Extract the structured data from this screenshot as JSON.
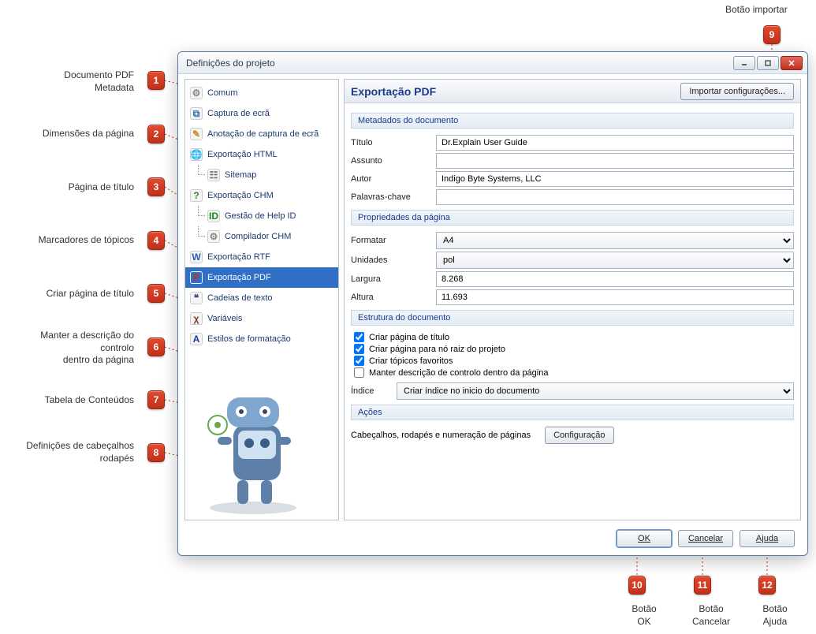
{
  "annotations": {
    "1": "Documento PDF\nMetadata",
    "2": "Dimensões da página",
    "3": "Página de título",
    "4": "Marcadores de tópicos",
    "5": "Criar página de título",
    "6": "Manter a descrição do\ncontrolo\ndentro da página",
    "7": "Tabela de Conteúdos",
    "8": "Definições de cabeçalhos\nrodapés",
    "9": "Botão importar",
    "10": "Botão\nOK",
    "11": "Botão\nCancelar",
    "12": "Botão\nAjuda"
  },
  "window": {
    "title": "Definições do projeto"
  },
  "nav": [
    {
      "label": "Comum",
      "icon": "⚙",
      "kind": "gear"
    },
    {
      "label": "Captura de ecrã",
      "icon": "⧉",
      "kind": "capture"
    },
    {
      "label": "Anotação de captura de ecrã",
      "icon": "✎",
      "kind": "annotate"
    },
    {
      "label": "Exportação HTML",
      "icon": "🌐",
      "kind": "html"
    },
    {
      "label": "Sitemap",
      "icon": "☷",
      "kind": "sitemap",
      "child": true
    },
    {
      "label": "Exportação CHM",
      "icon": "?",
      "kind": "chm"
    },
    {
      "label": "Gestão de Help ID",
      "icon": "ID",
      "kind": "helpid",
      "child": true
    },
    {
      "label": "Compilador CHM",
      "icon": "⚙",
      "kind": "chmcomp",
      "child": true
    },
    {
      "label": "Exportação RTF",
      "icon": "W",
      "kind": "rtf"
    },
    {
      "label": "Exportação PDF",
      "icon": "P",
      "kind": "pdf",
      "selected": true
    },
    {
      "label": "Cadeias de texto",
      "icon": "❝",
      "kind": "strings"
    },
    {
      "label": "Variáveis",
      "icon": "χ",
      "kind": "vars"
    },
    {
      "label": "Estilos de formatação",
      "icon": "A",
      "kind": "styles"
    }
  ],
  "panel": {
    "title": "Exportação PDF",
    "import_btn": "Importar configurações...",
    "sections": {
      "meta": {
        "header": "Metadados do documento",
        "title_label": "Título",
        "title_value": "Dr.Explain User Guide",
        "subject_label": "Assunto",
        "subject_value": "",
        "author_label": "Autor",
        "author_value": "Indigo Byte Systems, LLC",
        "keywords_label": "Palavras-chave",
        "keywords_value": ""
      },
      "page": {
        "header": "Propriedades da página",
        "format_label": "Formatar",
        "format_value": "A4",
        "units_label": "Unidades",
        "units_value": "pol",
        "width_label": "Largura",
        "width_value": "8.268",
        "height_label": "Altura",
        "height_value": "11.693"
      },
      "struct": {
        "header": "Estrutura do documento",
        "c1": "Criar página de título",
        "c2": "Criar página para nó raiz do projeto",
        "c3": "Criar tópicos favoritos",
        "c4": "Manter descrição de controlo dentro da página",
        "index_label": "Índice",
        "index_value": "Criar índice no inicio do documento"
      },
      "actions": {
        "header": "Ações",
        "hf_label": "Cabeçalhos, rodapés e numeração de páginas",
        "hf_btn": "Configuração"
      }
    }
  },
  "buttons": {
    "ok": "OK",
    "cancel": "Cancelar",
    "help": "Ajuda"
  }
}
